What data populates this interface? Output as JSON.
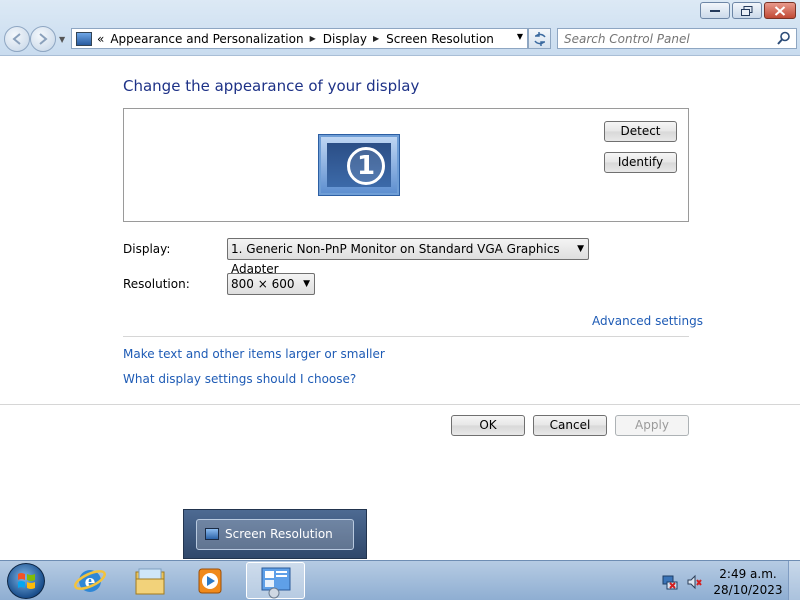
{
  "window": {
    "address": {
      "overflow": "«",
      "crumbs": [
        "Appearance and Personalization",
        "Display",
        "Screen Resolution"
      ]
    },
    "search_placeholder": "Search Control Panel"
  },
  "main": {
    "heading": "Change the appearance of your display",
    "monitor_number": "1",
    "detect_label": "Detect",
    "identify_label": "Identify",
    "display_label": "Display:",
    "display_value": "1. Generic Non-PnP Monitor on Standard VGA Graphics Adapter",
    "resolution_label": "Resolution:",
    "resolution_value": "800 × 600",
    "advanced_link": "Advanced settings",
    "link_larger": "Make text and other items larger or smaller",
    "link_choose": "What display settings should I choose?",
    "ok_label": "OK",
    "cancel_label": "Cancel",
    "apply_label": "Apply"
  },
  "taskbar": {
    "popup_title": "Screen Resolution",
    "clock_time": "2:49 a.m.",
    "clock_date": "28/10/2023",
    "icons": [
      "start-orb-icon",
      "internet-explorer-icon",
      "windows-explorer-icon",
      "media-player-icon",
      "control-panel-icon"
    ]
  },
  "colors": {
    "heading": "#1e3287",
    "link": "#1e5bb5"
  }
}
